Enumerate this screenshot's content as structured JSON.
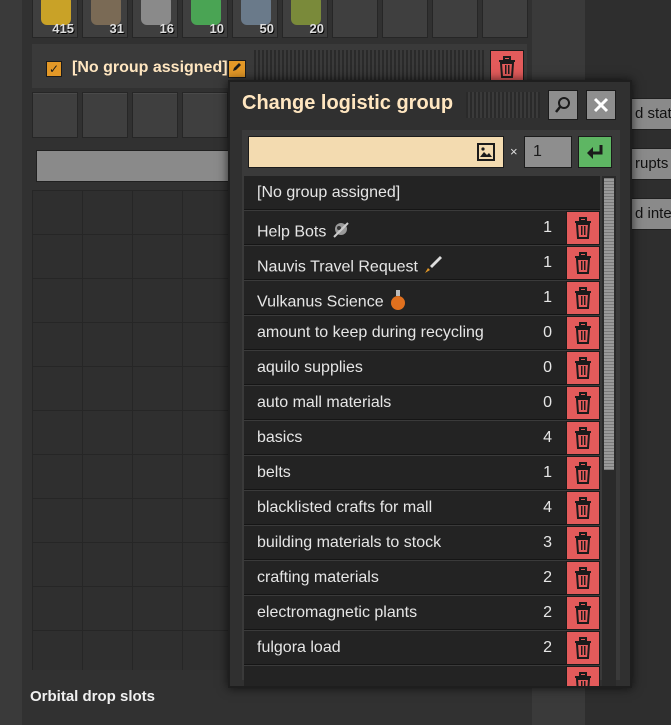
{
  "inventory": {
    "slots": [
      {
        "count": "415",
        "icon": "exoskeleton-icon",
        "color": "#c9a227"
      },
      {
        "count": "31",
        "icon": "rocket-fuel-icon",
        "color": "#7a6a55"
      },
      {
        "count": "16",
        "icon": "construction-robot-icon",
        "color": "#8a8a8a"
      },
      {
        "count": "10",
        "icon": "roboport-icon",
        "color": "#4aa454"
      },
      {
        "count": "50",
        "icon": "wire-icon",
        "color": "#6a7a8a"
      },
      {
        "count": "20",
        "icon": "assembler-icon",
        "color": "#7a8a3a"
      }
    ]
  },
  "section": {
    "group_label": "[No group assigned]"
  },
  "side_buttons": [
    "d stat",
    "rupts",
    "d inter"
  ],
  "footer": {
    "orbital_label": "Orbital drop slots"
  },
  "dialog": {
    "title": "Change logistic group",
    "search_value": "",
    "multiplier_symbol": "×",
    "quantity": "1",
    "groups": [
      {
        "name": "[No group assigned]",
        "count": "",
        "deletable": false
      },
      {
        "name": "Help Bots",
        "count": "1",
        "deletable": true,
        "icon": "construction-robot-icon"
      },
      {
        "name": "Nauvis Travel Request",
        "count": "1",
        "deletable": true,
        "icon": "rocket-icon"
      },
      {
        "name": "Vulkanus Science",
        "count": "1",
        "deletable": true,
        "icon": "science-pack-icon"
      },
      {
        "name": "amount to keep during recycling",
        "count": "0",
        "deletable": true
      },
      {
        "name": "aquilo supplies",
        "count": "0",
        "deletable": true
      },
      {
        "name": "auto mall materials",
        "count": "0",
        "deletable": true
      },
      {
        "name": "basics",
        "count": "4",
        "deletable": true
      },
      {
        "name": "belts",
        "count": "1",
        "deletable": true
      },
      {
        "name": "blacklisted crafts for mall",
        "count": "4",
        "deletable": true
      },
      {
        "name": "building materials to stock",
        "count": "3",
        "deletable": true
      },
      {
        "name": "crafting materials",
        "count": "2",
        "deletable": true
      },
      {
        "name": "electromagnetic plants",
        "count": "2",
        "deletable": true
      },
      {
        "name": "fulgora load",
        "count": "2",
        "deletable": true
      },
      {
        "name": "",
        "count": "",
        "deletable": true
      }
    ]
  },
  "colors": {
    "accent_orange": "#e39827",
    "delete_red": "#e35b5b",
    "confirm_green": "#5eb663",
    "title_text": "#ffe6c0"
  }
}
